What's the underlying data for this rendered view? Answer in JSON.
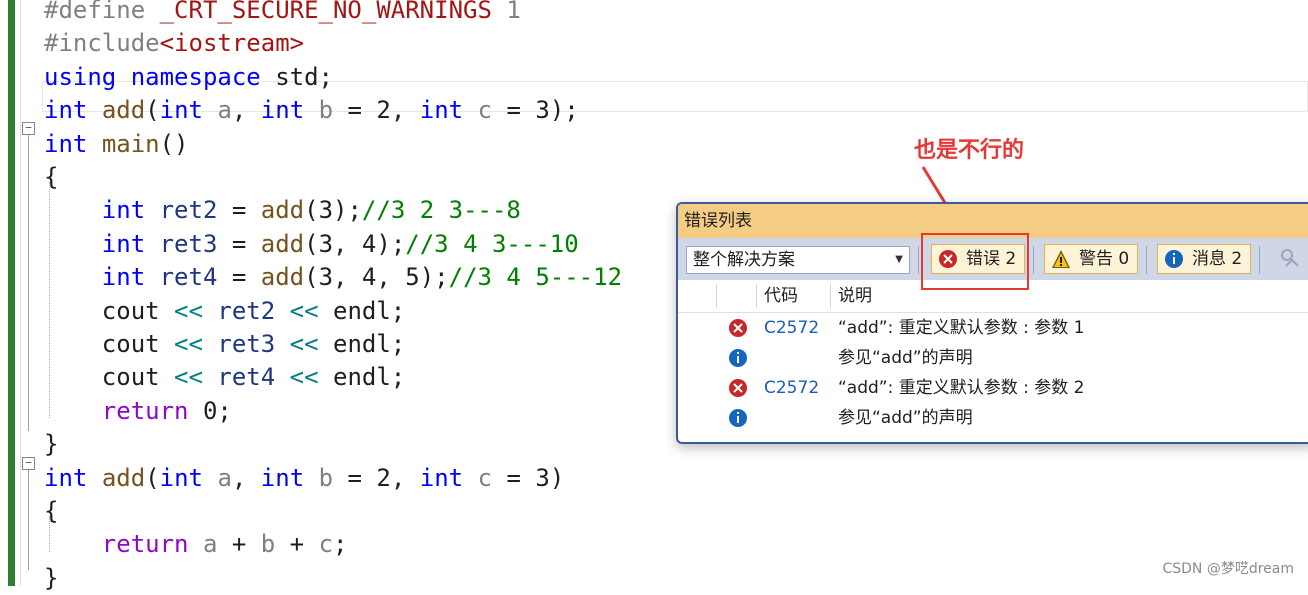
{
  "editor": {
    "lines": [
      {
        "segs": [
          [
            "pre",
            "#define "
          ],
          [
            "str",
            "_CRT_SECURE_NO_WARNINGS"
          ],
          [
            "pre",
            " 1"
          ]
        ]
      },
      {
        "segs": [
          [
            "pre",
            "#include"
          ],
          [
            "str",
            "<iostream>"
          ]
        ]
      },
      {
        "segs": [
          [
            "kw",
            "using"
          ],
          [
            "",
            " "
          ],
          [
            "kw",
            "namespace"
          ],
          [
            "",
            " std;"
          ]
        ]
      },
      {
        "segs": [
          [
            "kw",
            "int"
          ],
          [
            "",
            " "
          ],
          [
            "fn",
            "add"
          ],
          [
            "",
            "("
          ],
          [
            "kw",
            "int"
          ],
          [
            "",
            " "
          ],
          [
            "param",
            "a"
          ],
          [
            "",
            ", "
          ],
          [
            "kw",
            "int"
          ],
          [
            "",
            " "
          ],
          [
            "param",
            "b"
          ],
          [
            "",
            " = 2, "
          ],
          [
            "kw",
            "int"
          ],
          [
            "",
            " "
          ],
          [
            "param",
            "c"
          ],
          [
            "",
            " = 3);"
          ]
        ]
      },
      {
        "segs": [
          [
            "kw",
            "int"
          ],
          [
            "",
            " "
          ],
          [
            "fn",
            "main"
          ],
          [
            "",
            "()"
          ]
        ]
      },
      {
        "segs": [
          [
            "",
            "{"
          ]
        ]
      },
      {
        "segs": [
          [
            "",
            "    "
          ],
          [
            "kw",
            "int"
          ],
          [
            "",
            " "
          ],
          [
            "var",
            "ret2"
          ],
          [
            "",
            " = "
          ],
          [
            "fn",
            "add"
          ],
          [
            "",
            "(3);"
          ],
          [
            "cmt",
            "//3 2 3---8"
          ]
        ]
      },
      {
        "segs": [
          [
            "",
            "    "
          ],
          [
            "kw",
            "int"
          ],
          [
            "",
            " "
          ],
          [
            "var",
            "ret3"
          ],
          [
            "",
            " = "
          ],
          [
            "fn",
            "add"
          ],
          [
            "",
            "(3, 4);"
          ],
          [
            "cmt",
            "//3 4 3---10"
          ]
        ]
      },
      {
        "segs": [
          [
            "",
            "    "
          ],
          [
            "kw",
            "int"
          ],
          [
            "",
            " "
          ],
          [
            "var",
            "ret4"
          ],
          [
            "",
            " = "
          ],
          [
            "fn",
            "add"
          ],
          [
            "",
            "(3, 4, 5);"
          ],
          [
            "cmt",
            "//3 4 5---12"
          ]
        ]
      },
      {
        "segs": [
          [
            "",
            "    cout "
          ],
          [
            "op",
            "<<"
          ],
          [
            "",
            " "
          ],
          [
            "var",
            "ret2"
          ],
          [
            "",
            " "
          ],
          [
            "op",
            "<<"
          ],
          [
            "",
            " endl;"
          ]
        ]
      },
      {
        "segs": [
          [
            "",
            "    cout "
          ],
          [
            "op",
            "<<"
          ],
          [
            "",
            " "
          ],
          [
            "var",
            "ret3"
          ],
          [
            "",
            " "
          ],
          [
            "op",
            "<<"
          ],
          [
            "",
            " endl;"
          ]
        ]
      },
      {
        "segs": [
          [
            "",
            "    cout "
          ],
          [
            "op",
            "<<"
          ],
          [
            "",
            " "
          ],
          [
            "var",
            "ret4"
          ],
          [
            "",
            " "
          ],
          [
            "op",
            "<<"
          ],
          [
            "",
            " endl;"
          ]
        ]
      },
      {
        "segs": [
          [
            "",
            "    "
          ],
          [
            "kw2",
            "return"
          ],
          [
            "",
            " 0;"
          ]
        ]
      },
      {
        "segs": [
          [
            "",
            "}"
          ]
        ]
      },
      {
        "segs": [
          [
            "kw",
            "int"
          ],
          [
            "",
            " "
          ],
          [
            "fn",
            "add"
          ],
          [
            "",
            "("
          ],
          [
            "kw",
            "int"
          ],
          [
            "",
            " "
          ],
          [
            "param",
            "a"
          ],
          [
            "",
            ", "
          ],
          [
            "kw",
            "int"
          ],
          [
            "",
            " "
          ],
          [
            "param",
            "b"
          ],
          [
            "",
            " = 2, "
          ],
          [
            "kw",
            "int"
          ],
          [
            "",
            " "
          ],
          [
            "param",
            "c"
          ],
          [
            "",
            " = 3)"
          ]
        ]
      },
      {
        "segs": [
          [
            "",
            "{"
          ]
        ]
      },
      {
        "segs": [
          [
            "",
            "    "
          ],
          [
            "kw2",
            "return"
          ],
          [
            "",
            " "
          ],
          [
            "param",
            "a"
          ],
          [
            "",
            " + "
          ],
          [
            "param",
            "b"
          ],
          [
            "",
            " + "
          ],
          [
            "param",
            "c"
          ],
          [
            "",
            ";"
          ]
        ]
      },
      {
        "segs": [
          [
            "",
            "}"
          ]
        ]
      }
    ]
  },
  "annotation": {
    "text": "也是不行的",
    "color": "#e53935"
  },
  "error_list": {
    "title": "错误列表",
    "scope": "整个解决方案",
    "errors_label": "错误 2",
    "warnings_label": "警告 0",
    "messages_label": "消息 2",
    "columns": {
      "code": "代码",
      "description": "说明"
    },
    "rows": [
      {
        "icon": "error-icon",
        "code": "C2572",
        "description": "“add”: 重定义默认参数 : 参数 1"
      },
      {
        "icon": "info-icon",
        "code": "",
        "description": "参见“add”的声明"
      },
      {
        "icon": "error-icon",
        "code": "C2572",
        "description": "“add”: 重定义默认参数 : 参数 2"
      },
      {
        "icon": "info-icon",
        "code": "",
        "description": "参见“add”的声明"
      }
    ]
  },
  "watermark": "CSDN @梦呓dream"
}
